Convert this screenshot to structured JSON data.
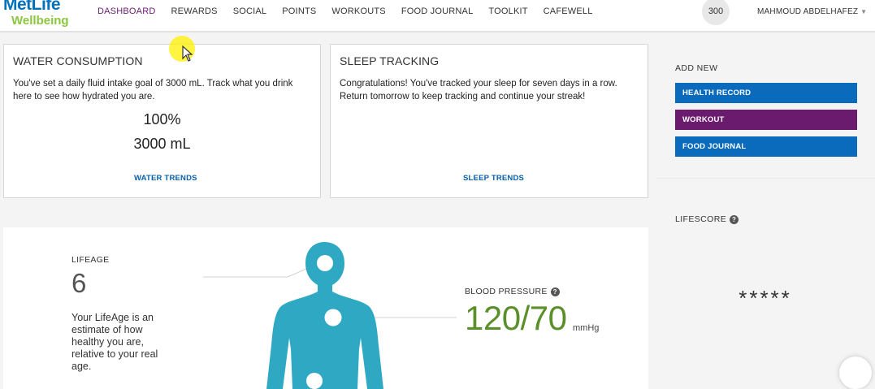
{
  "header": {
    "logo_line1": "MetLife",
    "logo_line2": "Wellbeing",
    "nav": [
      {
        "label": "DASHBOARD"
      },
      {
        "label": "REWARDS"
      },
      {
        "label": "SOCIAL"
      },
      {
        "label": "POINTS"
      },
      {
        "label": "WORKOUTS"
      },
      {
        "label": "FOOD JOURNAL"
      },
      {
        "label": "TOOLKIT"
      },
      {
        "label": "CAFEWELL"
      }
    ],
    "points": "300",
    "user_name": "MAHMOUD ABDELHAFEZ"
  },
  "water": {
    "title": "WATER CONSUMPTION",
    "text": "You've set a daily fluid intake goal of 3000 mL. Track what you drink here to see how hydrated you are.",
    "percent": "100%",
    "amount": "3000 mL",
    "link": "WATER TRENDS"
  },
  "sleep": {
    "title": "SLEEP TRACKING",
    "text": "Congratulations! You've tracked your sleep for seven days in a row. Return tomorrow to keep tracking and continue your streak!",
    "link": "SLEEP TRENDS"
  },
  "add_new": {
    "title": "ADD NEW",
    "buttons": [
      {
        "label": "HEALTH RECORD",
        "color": "#0a6bbd"
      },
      {
        "label": "WORKOUT",
        "color": "#6a1b6e"
      },
      {
        "label": "FOOD JOURNAL",
        "color": "#0a6bbd"
      }
    ]
  },
  "lifescore": {
    "title": "LIFESCORE",
    "value": "*****"
  },
  "lifeage": {
    "label": "LIFEAGE",
    "value": "6",
    "description": "Your LifeAge is an estimate of how healthy you are, relative to your real age."
  },
  "blood_pressure": {
    "label": "BLOOD PRESSURE",
    "value": "120/70",
    "unit": "mmHg"
  },
  "colors": {
    "active_nav": "#6a1b6e",
    "link": "#0a5fa8",
    "body_figure": "#2fa9c3",
    "bp_value": "#5a8f29"
  }
}
